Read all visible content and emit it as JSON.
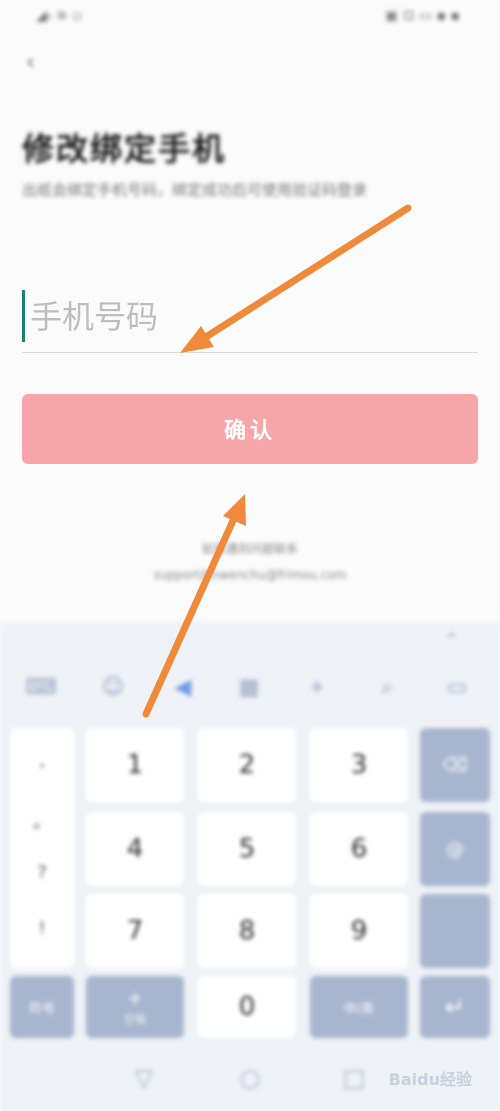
{
  "status_bar": {
    "left_text": "◢ᵢₗ ≋ ▫",
    "right_text": "▣ ⊡ ▭ ▪ ▪"
  },
  "header": {
    "back_icon": "back-arrow-icon",
    "title": "修改绑定手机",
    "subtitle": "出纸会绑定手机号码，绑定成功后可使用验证码登录"
  },
  "form": {
    "phone_placeholder": "手机号码",
    "phone_value": "",
    "confirm_label": "确认"
  },
  "help": {
    "line1": "如果遇到问题联系",
    "line2": "support@nwenchu@frimou.com"
  },
  "keyboard": {
    "toolbar_icons": [
      "keyboard-icon",
      "emoji-icon",
      "voice-icon",
      "grid-icon",
      "cursor-icon",
      "search-icon",
      "clipboard-icon"
    ],
    "symbols": [
      ",",
      "。",
      "?",
      "!"
    ],
    "digits": [
      "1",
      "2",
      "3",
      "4",
      "5",
      "6",
      "7",
      "8",
      "9",
      "0"
    ],
    "symbol_key": "符号",
    "plus_key": {
      "main": "+",
      "sub": "空格"
    },
    "letters_key": "中/英",
    "enter_key": "↵",
    "backspace_key": "⌫",
    "at_key": "@"
  },
  "nav_bar": {
    "icons": [
      "back-icon",
      "home-icon",
      "recents-icon"
    ]
  },
  "watermark": {
    "text": "Baidu经验"
  },
  "annotations": {
    "arrow_color": "#f08a3a"
  }
}
